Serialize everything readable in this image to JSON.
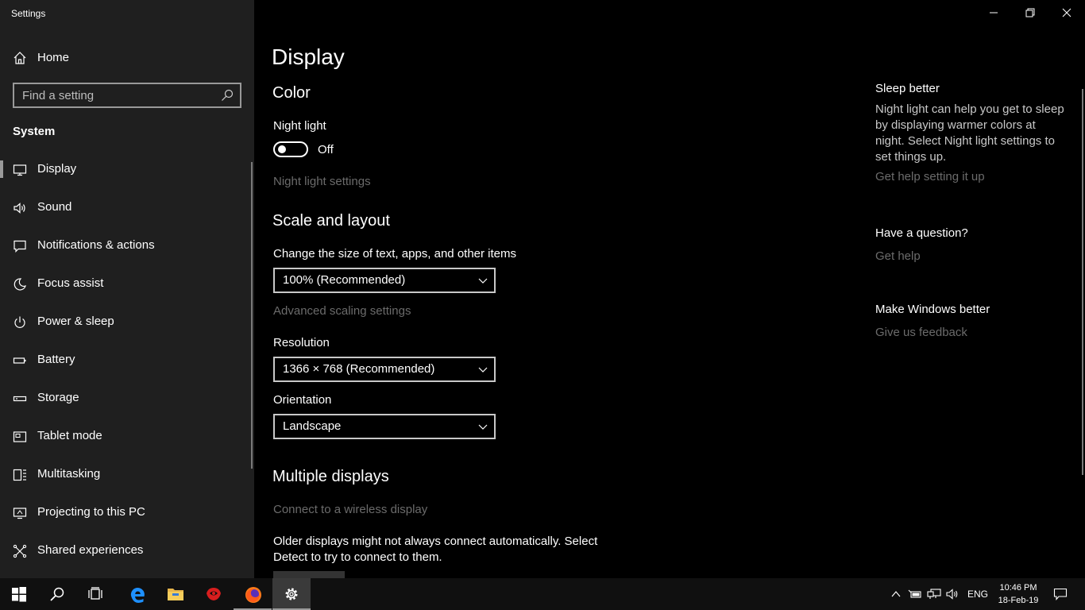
{
  "window": {
    "title": "Settings"
  },
  "sidebar": {
    "home_label": "Home",
    "search_placeholder": "Find a setting",
    "section_label": "System",
    "items": [
      {
        "label": "Display",
        "icon": "monitor-icon",
        "active": true
      },
      {
        "label": "Sound",
        "icon": "speaker-icon"
      },
      {
        "label": "Notifications & actions",
        "icon": "notification-icon"
      },
      {
        "label": "Focus assist",
        "icon": "moon-icon"
      },
      {
        "label": "Power & sleep",
        "icon": "power-icon"
      },
      {
        "label": "Battery",
        "icon": "battery-icon"
      },
      {
        "label": "Storage",
        "icon": "storage-icon"
      },
      {
        "label": "Tablet mode",
        "icon": "tablet-icon"
      },
      {
        "label": "Multitasking",
        "icon": "multitasking-icon"
      },
      {
        "label": "Projecting to this PC",
        "icon": "projecting-icon"
      },
      {
        "label": "Shared experiences",
        "icon": "shared-icon"
      }
    ]
  },
  "main": {
    "page_title": "Display",
    "color": {
      "heading": "Color",
      "night_light_label": "Night light",
      "night_light_state": "Off",
      "night_light_settings_link": "Night light settings"
    },
    "scale": {
      "heading": "Scale and layout",
      "size_label": "Change the size of text, apps, and other items",
      "size_value": "100% (Recommended)",
      "advanced_link": "Advanced scaling settings",
      "resolution_label": "Resolution",
      "resolution_value": "1366 × 768 (Recommended)",
      "orientation_label": "Orientation",
      "orientation_value": "Landscape"
    },
    "multiple": {
      "heading": "Multiple displays",
      "wireless_link": "Connect to a wireless display",
      "description": "Older displays might not always connect automatically. Select Detect to try to connect to them."
    }
  },
  "help": {
    "sleep_title": "Sleep better",
    "sleep_text": "Night light can help you get to sleep by displaying warmer colors at night. Select Night light settings to set things up.",
    "sleep_link": "Get help setting it up",
    "question_title": "Have a question?",
    "question_link": "Get help",
    "feedback_title": "Make Windows better",
    "feedback_link": "Give us feedback"
  },
  "taskbar": {
    "language": "ENG",
    "time": "10:46 PM",
    "date": "18-Feb-19"
  },
  "colors": {
    "sidebar_bg": "#1f1f1f",
    "main_bg": "#000000",
    "disabled_link": "#6b6b6b",
    "edge_blue": "#1e90ff",
    "firefox_orange": "#ff7a1a"
  }
}
